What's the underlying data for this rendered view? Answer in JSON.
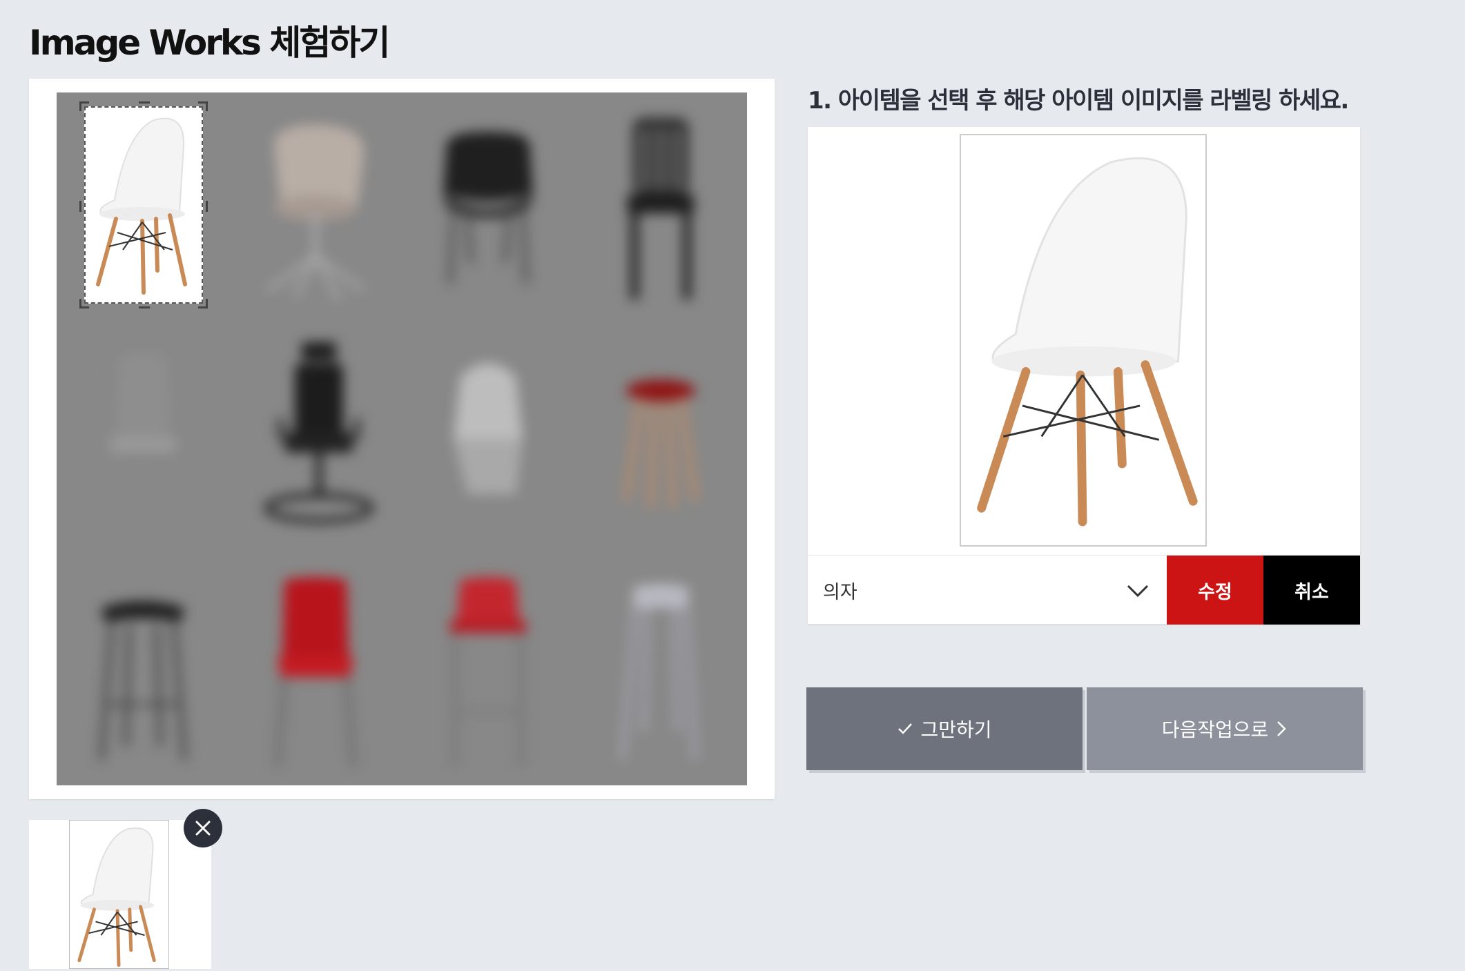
{
  "page": {
    "title": "Image Works 체험하기"
  },
  "instruction": "1. 아이템을 선택 후 해당 아이템 이미지를 라벨링 하세요.",
  "label_panel": {
    "selected_label": "의자",
    "edit_label": "수정",
    "cancel_label": "취소"
  },
  "actions": {
    "stop_label": "그만하기",
    "next_label": "다음작업으로"
  },
  "colors": {
    "background": "#e6e9ed",
    "edit_button": "#cc1414",
    "cancel_button": "#000000",
    "stop_button": "#6e727c",
    "next_button": "#8d919b",
    "close_badge": "#2b303b"
  },
  "gallery": {
    "items": [
      {
        "name": "white-chair",
        "selected": true
      },
      {
        "name": "taupe-swivel-armchair"
      },
      {
        "name": "black-armchair"
      },
      {
        "name": "black-metal-chair"
      },
      {
        "name": "grey-side-chair"
      },
      {
        "name": "black-office-chair"
      },
      {
        "name": "white-shell-chair"
      },
      {
        "name": "red-wooden-stool"
      },
      {
        "name": "black-bar-stool"
      },
      {
        "name": "red-chair"
      },
      {
        "name": "red-bar-stool"
      },
      {
        "name": "white-bar-stool"
      }
    ]
  },
  "icons": {
    "dropdown": "chevron-down-icon",
    "stop": "check-icon",
    "next": "chevron-right-icon",
    "remove": "close-icon"
  }
}
